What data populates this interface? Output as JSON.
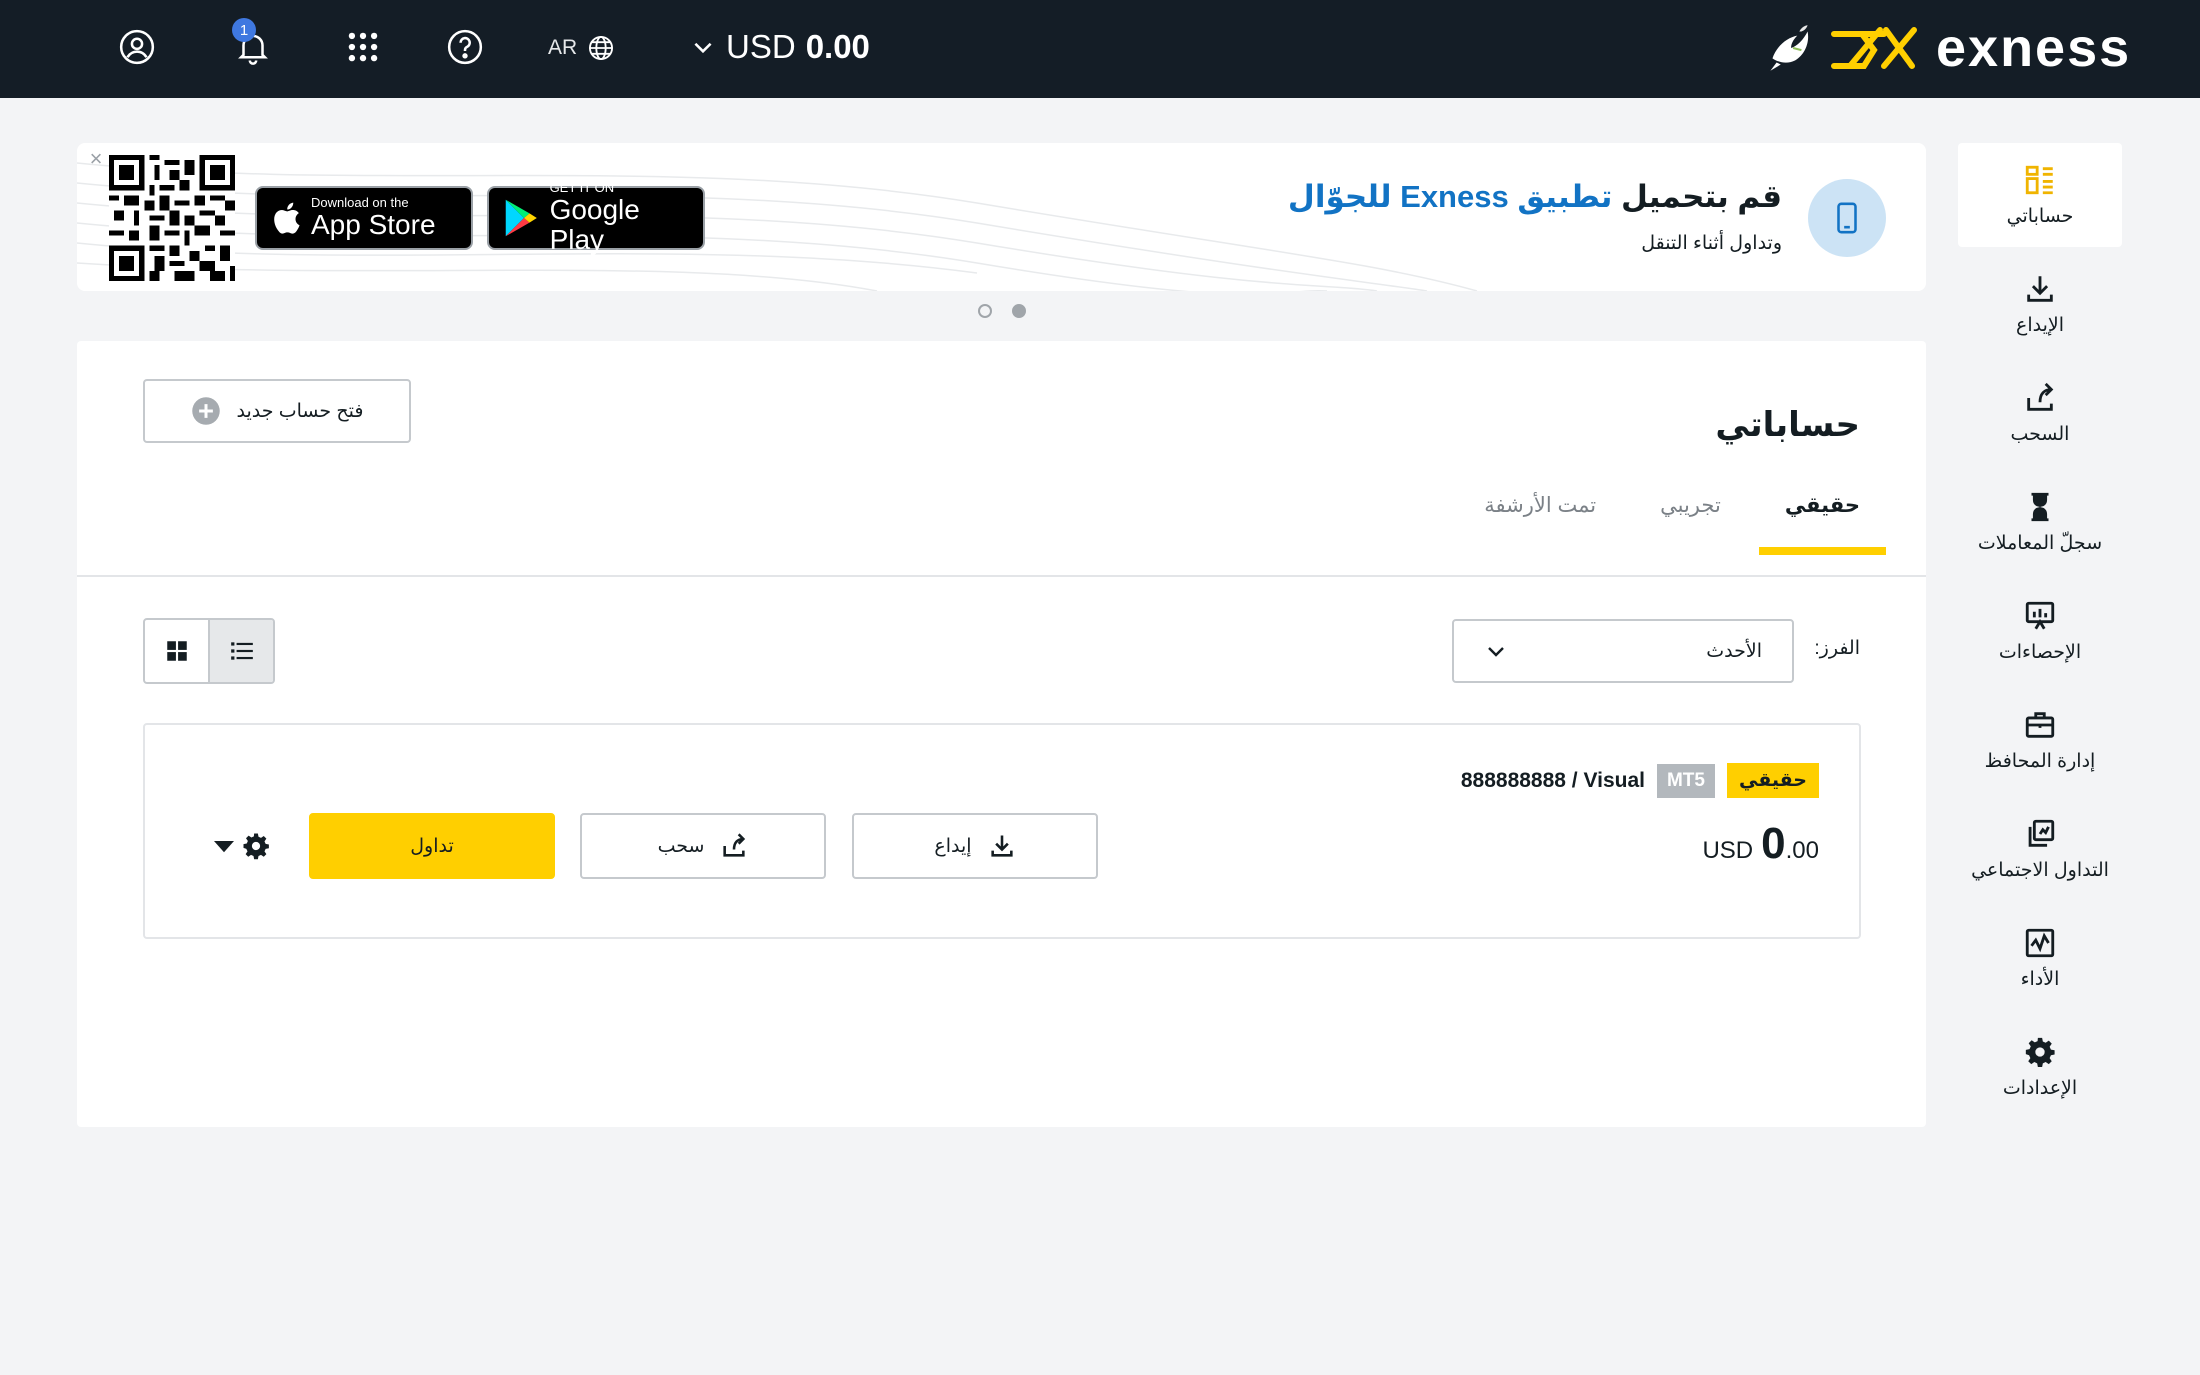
{
  "topbar": {
    "lang": "AR",
    "notifications_count": "1",
    "balance_currency": "USD",
    "balance_amount": "0.00",
    "logo_text": "exness"
  },
  "sidebar": {
    "items": [
      {
        "label": "حساباتي",
        "icon": "accounts-icon",
        "active": true
      },
      {
        "label": "الإيداع",
        "icon": "deposit-icon"
      },
      {
        "label": "السحب",
        "icon": "withdraw-icon"
      },
      {
        "label": "سجلّ المعاملات",
        "icon": "hourglass-icon"
      },
      {
        "label": "الإحصاءات",
        "icon": "analytics-icon"
      },
      {
        "label": "إدارة المحافظ",
        "icon": "briefcase-icon"
      },
      {
        "label": "التداول الاجتماعي",
        "icon": "social-trading-icon"
      },
      {
        "label": "الأداء",
        "icon": "performance-icon"
      },
      {
        "label": "الإعدادات",
        "icon": "gear-icon"
      }
    ]
  },
  "banner": {
    "title_prefix": "قم بتحميل ",
    "title_highlight": "تطبيق Exness للجوّال",
    "subtitle": "وتداول أثناء التنقل",
    "appstore_small": "Download on the",
    "appstore_big": "App Store",
    "gplay_small": "GET IT ON",
    "gplay_big": "Google Play"
  },
  "main": {
    "title": "حساباتي",
    "open_account": "فتح حساب جديد",
    "tabs": [
      {
        "label": "حقيقي",
        "active": true
      },
      {
        "label": "تجريبي"
      },
      {
        "label": "تمت الأرشفة"
      }
    ],
    "sort_label": "الفرز:",
    "sort_value": "الأحدث"
  },
  "account": {
    "type_badge": "حقيقي",
    "platform_badge": "MT5",
    "name": "888888888 / Visual",
    "currency": "USD",
    "balance_int": "0",
    "balance_dec": ".00",
    "deposit_label": "إيداع",
    "withdraw_label": "سحب",
    "trade_label": "تداول"
  },
  "colors": {
    "accent": "#ffcf00",
    "topbar": "#141d26",
    "link": "#1273c4"
  }
}
